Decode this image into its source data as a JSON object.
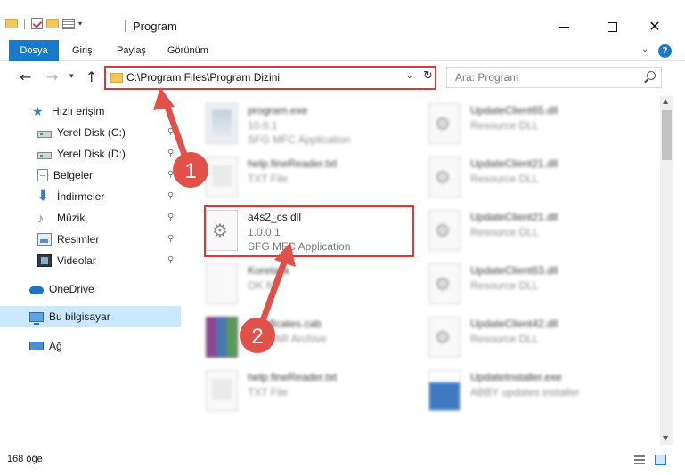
{
  "window": {
    "title": "Program"
  },
  "ribbon": {
    "tabs": [
      "Dosya",
      "Giriş",
      "Paylaş",
      "Görünüm"
    ]
  },
  "address": {
    "path": "C:\\Program Files\\Program Dizini"
  },
  "search": {
    "placeholder": "Ara: Program"
  },
  "sidebar": {
    "items": [
      {
        "label": "Hızlı erişim",
        "icon": "star-icon"
      },
      {
        "label": "Yerel Disk (C:)",
        "icon": "disk-icon"
      },
      {
        "label": "Yerel Disk (D:)",
        "icon": "disk-icon"
      },
      {
        "label": "Belgeler",
        "icon": "documents-icon"
      },
      {
        "label": "İndirmeler",
        "icon": "download-icon"
      },
      {
        "label": "Müzik",
        "icon": "music-icon"
      },
      {
        "label": "Resimler",
        "icon": "pictures-icon"
      },
      {
        "label": "Videolar",
        "icon": "videos-icon"
      },
      {
        "label": "OneDrive",
        "icon": "cloud-icon"
      },
      {
        "label": "Bu bilgisayar",
        "icon": "computer-icon"
      },
      {
        "label": "Ağ",
        "icon": "network-icon"
      }
    ]
  },
  "files": {
    "left": [
      {
        "name": "program.exe",
        "line1": "10.0.1",
        "line2": "SFG MFC Application",
        "icon": "exe-icon",
        "blurred": true
      },
      {
        "name": "help.fineReader.txt",
        "line1": "TXT File",
        "line2": "",
        "icon": "text-file-icon",
        "blurred": true
      },
      {
        "name": "a4s2_cs.dll",
        "line1": "1.0.0.1",
        "line2": "SFG MFC Application",
        "icon": "dll-gear-icon",
        "blurred": false
      },
      {
        "name": "Koretask",
        "line1": "OK file",
        "line2": "",
        "icon": "file-icon",
        "blurred": true
      },
      {
        "name": "Certificates.cab",
        "line1": "WinRAR Archive",
        "line2": "",
        "icon": "winrar-icon",
        "blurred": true
      },
      {
        "name": "help.fineReader.txt",
        "line1": "TXT File",
        "line2": "",
        "icon": "text-file-icon",
        "blurred": true
      }
    ],
    "right": [
      {
        "name": "UpdateClient65.dll",
        "line1": "Resource DLL",
        "icon": "dll-gear-icon"
      },
      {
        "name": "UpdateClient21.dll",
        "line1": "Resource DLL",
        "icon": "dll-gear-icon"
      },
      {
        "name": "UpdateClient21.dll",
        "line1": "Resource DLL",
        "icon": "dll-gear-icon"
      },
      {
        "name": "UpdateClient63.dll",
        "line1": "Resource DLL",
        "icon": "dll-gear-icon"
      },
      {
        "name": "UpdateClient42.dll",
        "line1": "Resource DLL",
        "icon": "dll-gear-icon"
      },
      {
        "name": "UpdateInstaller.exe",
        "line1": "ABBY updates installer",
        "icon": "installer-icon"
      }
    ]
  },
  "status": {
    "count": "168 öğe"
  },
  "annotations": {
    "step1": "1",
    "step2": "2",
    "color": "#e0514a"
  }
}
